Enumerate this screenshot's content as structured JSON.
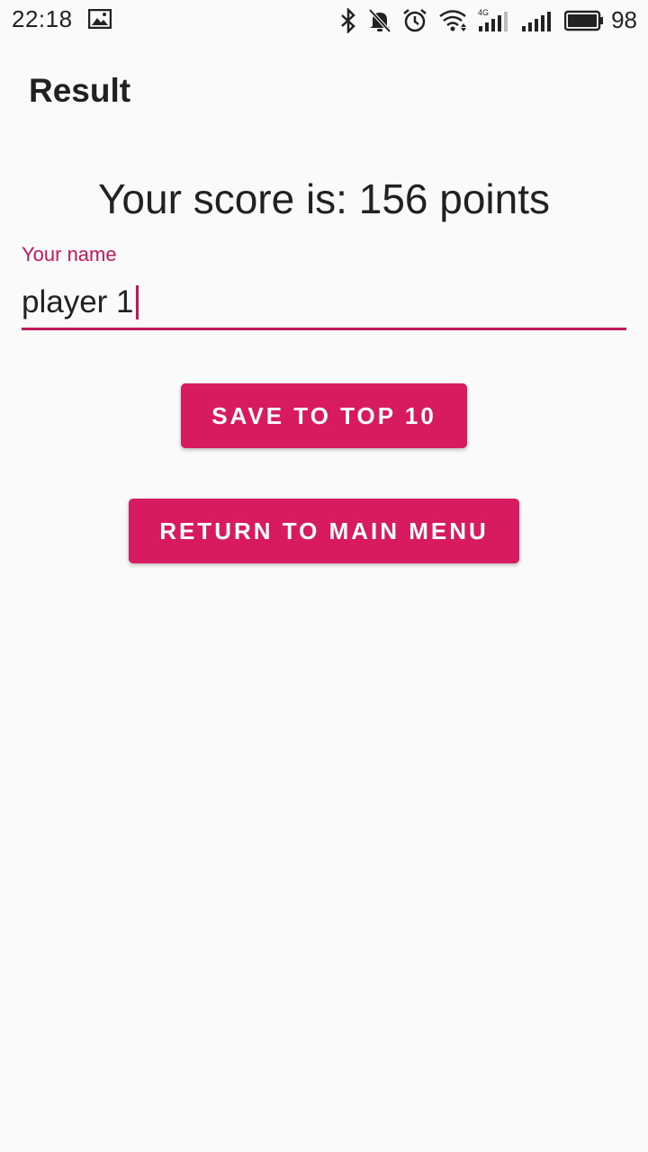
{
  "status_bar": {
    "time": "22:18",
    "battery_level": "98",
    "icons": [
      "gallery-icon",
      "bluetooth-icon",
      "muted-bell-icon",
      "alarm-icon",
      "wifi-icon",
      "signal-4g-icon",
      "signal-icon",
      "battery-icon"
    ],
    "network_label": "4G"
  },
  "app_bar": {
    "title": "Result"
  },
  "main": {
    "score_text": "Your score is: 156 points",
    "name_field": {
      "label": "Your name",
      "value": "player 1"
    },
    "save_button_label": "SAVE TO TOP 10",
    "menu_button_label": "RETURN TO MAIN MENU"
  },
  "colors": {
    "accent": "#d81b60",
    "accent_dark": "#c2185b",
    "background": "#fafafa",
    "text": "#212121"
  }
}
